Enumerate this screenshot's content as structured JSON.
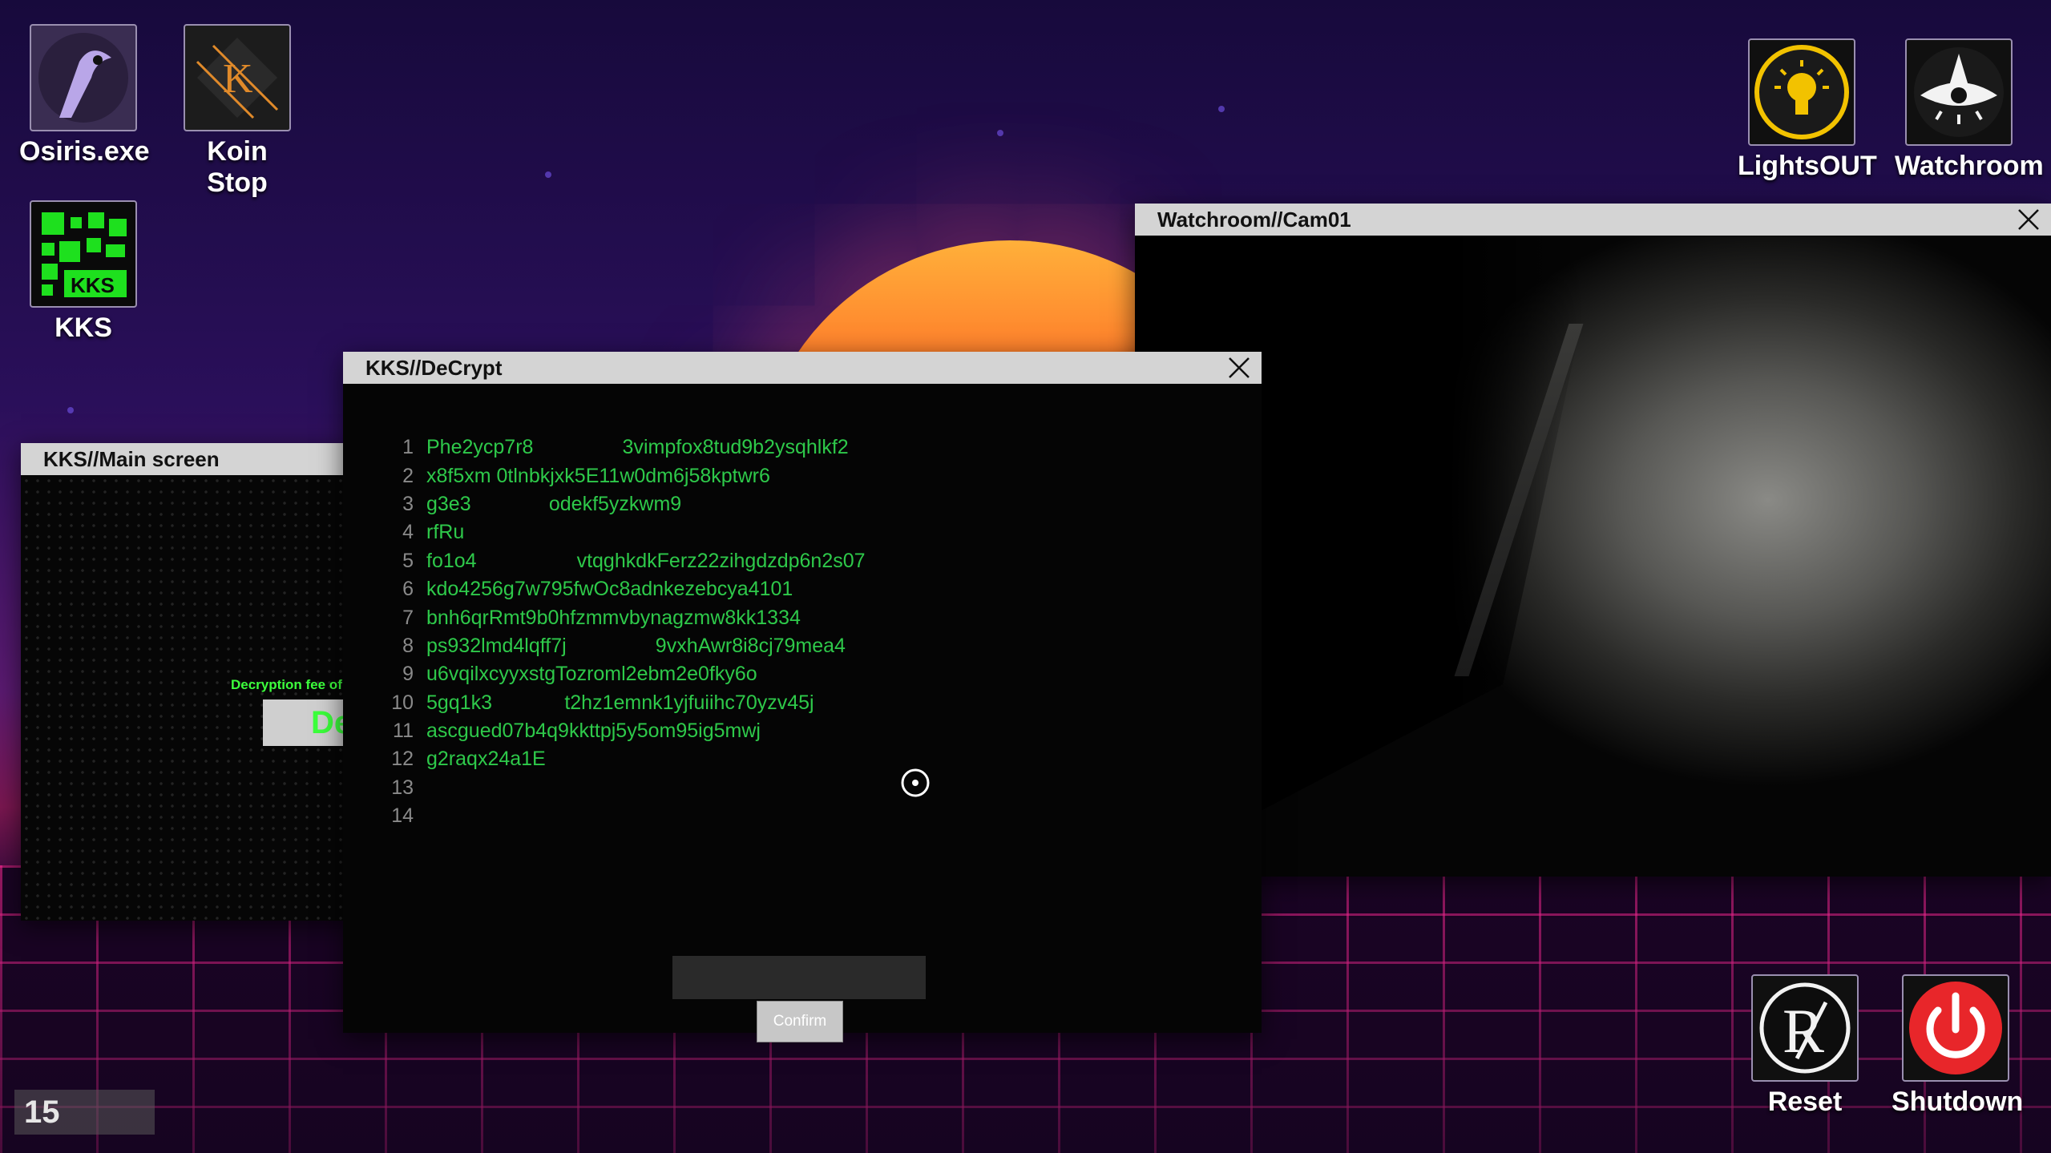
{
  "desktop": {
    "icons": [
      {
        "label": "Osiris.exe",
        "icon": "osiris-icon"
      },
      {
        "label": "Koin Stop",
        "icon": "koin-stop-icon"
      },
      {
        "label": "KKS",
        "icon": "kks-icon"
      },
      {
        "label": "LightsOUT",
        "icon": "lightbulb-icon"
      },
      {
        "label": "Watchroom",
        "icon": "eye-icon"
      },
      {
        "label": "Reset",
        "icon": "reset-icon"
      },
      {
        "label": "Shutdown",
        "icon": "power-icon"
      }
    ],
    "counter": "15"
  },
  "main_window": {
    "title": "KKS//Main screen",
    "fee_text": "Decryption fee of",
    "button_label": "DeC"
  },
  "decrypt_window": {
    "title": "KKS//DeCrypt",
    "lines": [
      {
        "num": "1",
        "text": "Phe2ycp7r8                3vimpfox8tud9b2ysqhlkf2"
      },
      {
        "num": "2",
        "text": "x8f5xm 0tlnbkjxk5E11w0dm6j58kptwr6"
      },
      {
        "num": "3",
        "text": "g3e3              odekf5yzkwm9"
      },
      {
        "num": "4",
        "text": "rfRu"
      },
      {
        "num": "5",
        "text": "fo1o4                  vtqghkdkFerz22zihgdzdp6n2s07"
      },
      {
        "num": "6",
        "text": "kdo4256g7w795fwOc8adnkezebcya4101"
      },
      {
        "num": "7",
        "text": "bnh6qrRmt9b0hfzmmvbynagzmw8kk1334"
      },
      {
        "num": "8",
        "text": "ps932lmd4lqff7j                9vxhAwr8i8cj79mea4"
      },
      {
        "num": "9",
        "text": "u6vqilxcyyxstgTozroml2ebm2e0fky6o"
      },
      {
        "num": "10",
        "text": "5gq1k3             t2hz1emnk1yjfuiihc70yzv45j"
      },
      {
        "num": "11",
        "text": "ascgued07b4q9kkttpj5y5om95ig5mwj"
      },
      {
        "num": "12",
        "text": "g2raqx24a1E"
      },
      {
        "num": "13",
        "text": ""
      },
      {
        "num": "14",
        "text": ""
      }
    ],
    "input_value": "",
    "confirm_label": "Confirm"
  },
  "watch_window": {
    "title": "Watchroom//Cam01"
  },
  "colors": {
    "terminal_green": "#2ec94a",
    "lights_yellow": "#f2c200",
    "power_red": "#e8262a"
  }
}
